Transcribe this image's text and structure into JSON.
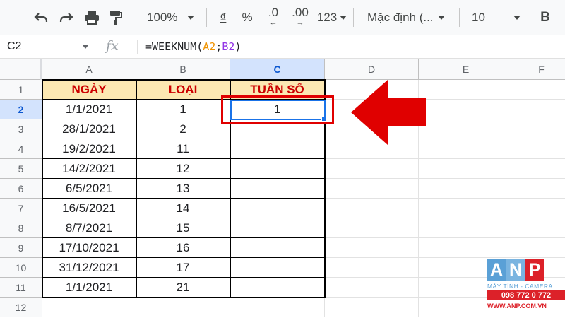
{
  "toolbar": {
    "undo_icon": "undo-icon",
    "redo_icon": "redo-icon",
    "print_icon": "print-icon",
    "paint_format_icon": "paint-format-icon",
    "zoom": "100%",
    "currency": "₫",
    "percent": "%",
    "decrease_decimal": ".0",
    "increase_decimal": ".00",
    "more_formats": "123",
    "font_family": "Mặc định (...",
    "font_size": "10",
    "bold": "B"
  },
  "formula_bar": {
    "name_box": "C2",
    "fx_label": "fx",
    "formula_prefix": "=WEEKNUM(",
    "formula_ref_a": "A2",
    "formula_sep": ";",
    "formula_ref_b": "B2",
    "formula_suffix": ")"
  },
  "columns": [
    "A",
    "B",
    "C",
    "D",
    "E",
    "F"
  ],
  "rows": [
    "1",
    "2",
    "3",
    "4",
    "5",
    "6",
    "7",
    "8",
    "9",
    "10",
    "11",
    "12"
  ],
  "table": {
    "headers": [
      "NGÀY",
      "LOẠI",
      "TUẦN SỐ"
    ],
    "data": [
      [
        "1/1/2021",
        "1",
        "1"
      ],
      [
        "28/1/2021",
        "2",
        ""
      ],
      [
        "19/2/2021",
        "11",
        ""
      ],
      [
        "14/2/2021",
        "12",
        ""
      ],
      [
        "6/5/2021",
        "13",
        ""
      ],
      [
        "16/5/2021",
        "14",
        ""
      ],
      [
        "8/7/2021",
        "15",
        ""
      ],
      [
        "17/10/2021",
        "16",
        ""
      ],
      [
        "31/12/2021",
        "17",
        ""
      ],
      [
        "1/1/2021",
        "21",
        ""
      ]
    ]
  },
  "selected_cell": "C2",
  "colors": {
    "header_fill": "#fce8b2",
    "header_text": "#cc0000",
    "selection": "#1a73e8",
    "highlight": "#e00000"
  },
  "watermark": {
    "letters": [
      "A",
      "N",
      "P"
    ],
    "subtitle": "MÁY TÍNH - CAMERA",
    "phone": "098 772 0 772",
    "url": "WWW.ANP.COM.VN"
  }
}
